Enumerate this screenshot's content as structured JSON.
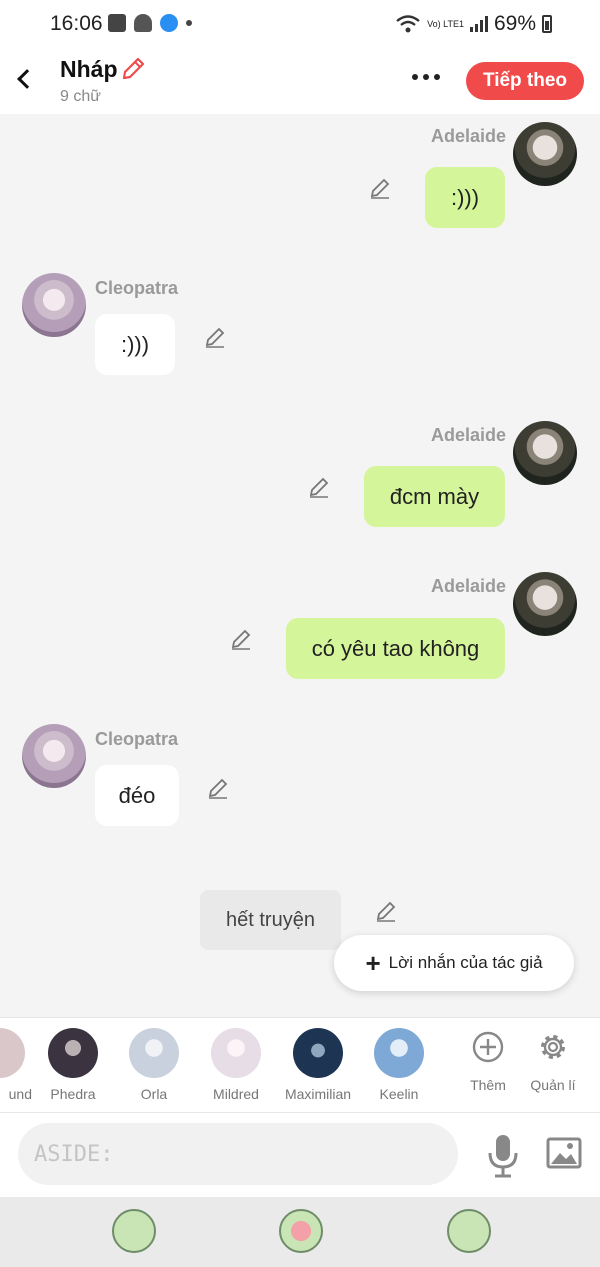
{
  "status_bar": {
    "time": "16:06",
    "network": "Vo) LTE1",
    "battery": "69%"
  },
  "header": {
    "title": "Nháp",
    "word_count": "9 chữ",
    "next_label": "Tiếp theo"
  },
  "messages": [
    {
      "speaker": "Adelaide",
      "text": ":)))",
      "side": "right"
    },
    {
      "speaker": "Cleopatra",
      "text": ":)))",
      "side": "left"
    },
    {
      "speaker": "Adelaide",
      "text": "đcm mày",
      "side": "right"
    },
    {
      "speaker": "Adelaide",
      "text": "có yêu tao không",
      "side": "right"
    },
    {
      "speaker": "Cleopatra",
      "text": "đéo",
      "side": "left"
    }
  ],
  "aside_message": "hết truyện",
  "author_note_label": "Lời nhắn của tác giả",
  "characters": [
    {
      "name": "und",
      "color": "#d9c7c9"
    },
    {
      "name": "Phedra",
      "color": "#3b3440"
    },
    {
      "name": "Orla",
      "color": "#c9d0de"
    },
    {
      "name": "Mildred",
      "color": "#e6dde6"
    },
    {
      "name": "Maximilian",
      "color": "#1d3553"
    },
    {
      "name": "Keelin",
      "color": "#7ea8d6"
    }
  ],
  "tools": {
    "add_label": "Thêm",
    "manage_label": "Quản lí"
  },
  "input": {
    "placeholder": "ASIDE:"
  },
  "colors": {
    "accent": "#f14a4a",
    "bubble_green": "#d5f59a",
    "bubble_white": "#ffffff"
  },
  "icons": [
    "back-icon",
    "pencil-icon",
    "more-icon",
    "plus-icon",
    "add-circle-icon",
    "gear-icon",
    "microphone-icon",
    "image-icon",
    "lily-pad-icon",
    "lotus-icon"
  ]
}
